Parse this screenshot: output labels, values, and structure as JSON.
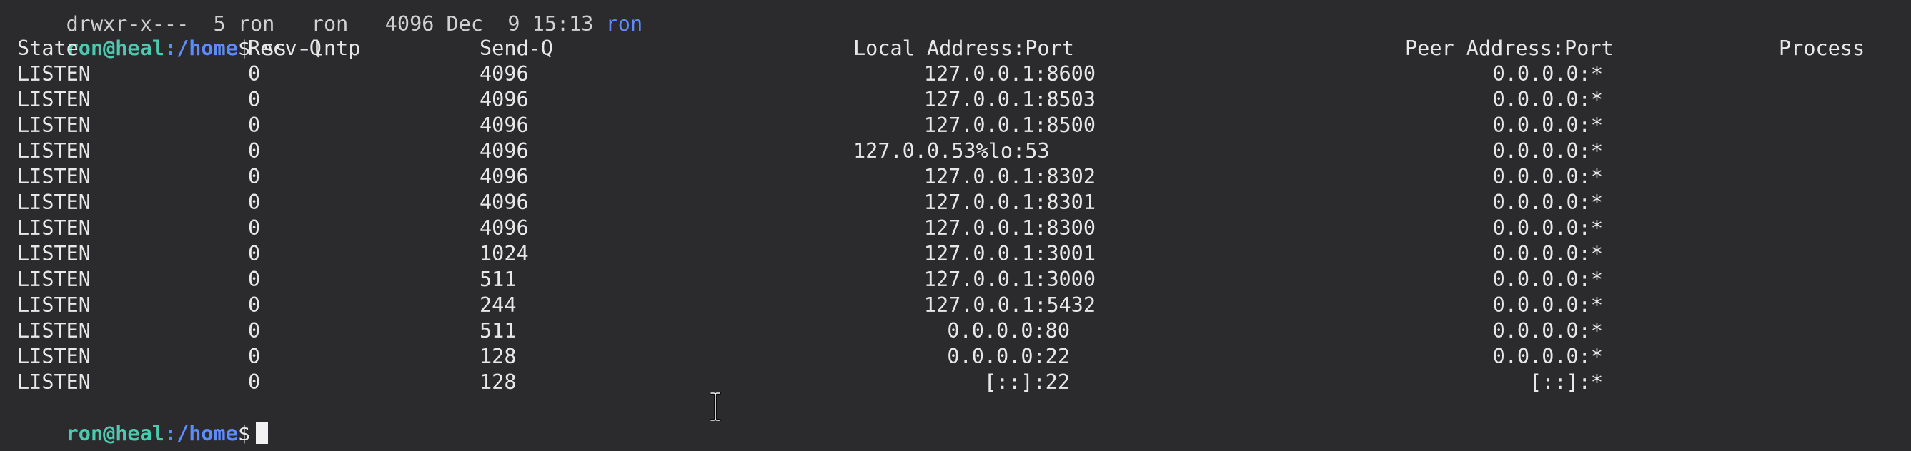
{
  "terminal": {
    "top_cutoff": {
      "text": "drwxr-x---  5 ron   ron   4096 Dec  9 15:13 ",
      "dir": "ron"
    },
    "prompt": {
      "user_host": "ron@heal",
      "path": ":/home",
      "symbol": "$"
    },
    "command": " ss -lntp",
    "columns": [
      "State",
      "Recv-Q",
      "Send-Q",
      "Local Address:Port",
      "Peer Address:Port",
      "Process"
    ],
    "rows": [
      {
        "state": "LISTEN",
        "recv_q": "0",
        "send_q": "4096",
        "local": "127.0.0.1:8600",
        "peer": "0.0.0.0:*"
      },
      {
        "state": "LISTEN",
        "recv_q": "0",
        "send_q": "4096",
        "local": "127.0.0.1:8503",
        "peer": "0.0.0.0:*"
      },
      {
        "state": "LISTEN",
        "recv_q": "0",
        "send_q": "4096",
        "local": "127.0.0.1:8500",
        "peer": "0.0.0.0:*"
      },
      {
        "state": "LISTEN",
        "recv_q": "0",
        "send_q": "4096",
        "local": "127.0.0.53%lo:53",
        "peer": "0.0.0.0:*"
      },
      {
        "state": "LISTEN",
        "recv_q": "0",
        "send_q": "4096",
        "local": "127.0.0.1:8302",
        "peer": "0.0.0.0:*"
      },
      {
        "state": "LISTEN",
        "recv_q": "0",
        "send_q": "4096",
        "local": "127.0.0.1:8301",
        "peer": "0.0.0.0:*"
      },
      {
        "state": "LISTEN",
        "recv_q": "0",
        "send_q": "4096",
        "local": "127.0.0.1:8300",
        "peer": "0.0.0.0:*"
      },
      {
        "state": "LISTEN",
        "recv_q": "0",
        "send_q": "1024",
        "local": "127.0.0.1:3001",
        "peer": "0.0.0.0:*"
      },
      {
        "state": "LISTEN",
        "recv_q": "0",
        "send_q": "511",
        "local": "127.0.0.1:3000",
        "peer": "0.0.0.0:*"
      },
      {
        "state": "LISTEN",
        "recv_q": "0",
        "send_q": "244",
        "local": "127.0.0.1:5432",
        "peer": "0.0.0.0:*"
      },
      {
        "state": "LISTEN",
        "recv_q": "0",
        "send_q": "511",
        "local": "0.0.0.0:80",
        "peer": "0.0.0.0:*"
      },
      {
        "state": "LISTEN",
        "recv_q": "0",
        "send_q": "128",
        "local": "0.0.0.0:22",
        "peer": "0.0.0.0:*"
      },
      {
        "state": "LISTEN",
        "recv_q": "0",
        "send_q": "128",
        "local": "[::]:22",
        "peer": "[::]:*"
      }
    ],
    "colors": {
      "background": "#2b2b2d",
      "text": "#e8e8e8",
      "prompt_user": "#4ec9b0",
      "prompt_path": "#5d8bff"
    },
    "icons": [
      "text-cursor-block-icon",
      "mouse-ibeam-icon"
    ]
  }
}
